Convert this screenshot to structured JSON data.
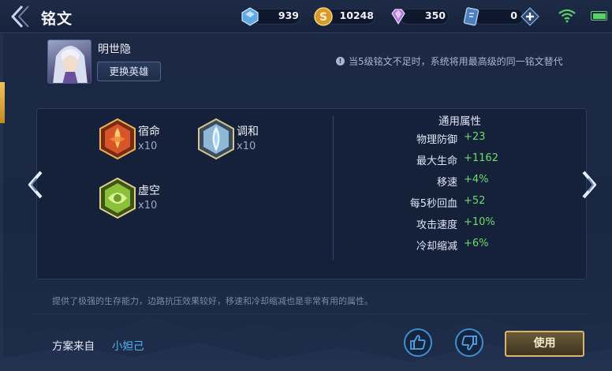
{
  "header": {
    "title": "铭文",
    "resources": [
      {
        "icon": "crystal-icon",
        "value": "939"
      },
      {
        "icon": "gold-coin-icon",
        "value": "10248"
      },
      {
        "icon": "diamond-icon",
        "value": "350"
      },
      {
        "icon": "voucher-icon",
        "value": "0"
      }
    ]
  },
  "hero": {
    "name": "明世隐",
    "swap_label": "更换英雄"
  },
  "notice": "当5级铭文不足时，系统将用最高级的同一铭文替代",
  "runes": [
    {
      "name": "宿命",
      "count": "x10",
      "color": "#d8552a"
    },
    {
      "name": "调和",
      "count": "x10",
      "color": "#8fb7d6"
    },
    {
      "name": "虚空",
      "count": "x10",
      "color": "#8cc03a"
    }
  ],
  "attributes": {
    "title": "通用属性",
    "rows": [
      {
        "name": "物理防御",
        "value": "+23"
      },
      {
        "name": "最大生命",
        "value": "+1162"
      },
      {
        "name": "移速",
        "value": "+4%"
      },
      {
        "name": "每5秒回血",
        "value": "+52"
      },
      {
        "name": "攻击速度",
        "value": "+10%"
      },
      {
        "name": "冷却缩减",
        "value": "+6%"
      }
    ]
  },
  "description": "提供了极强的生存能力，边路抗压效果较好，移速和冷却缩减也是非常有用的属性。",
  "source": {
    "label": "方案来自",
    "author": "小妲己"
  },
  "actions": {
    "use_label": "使用"
  }
}
